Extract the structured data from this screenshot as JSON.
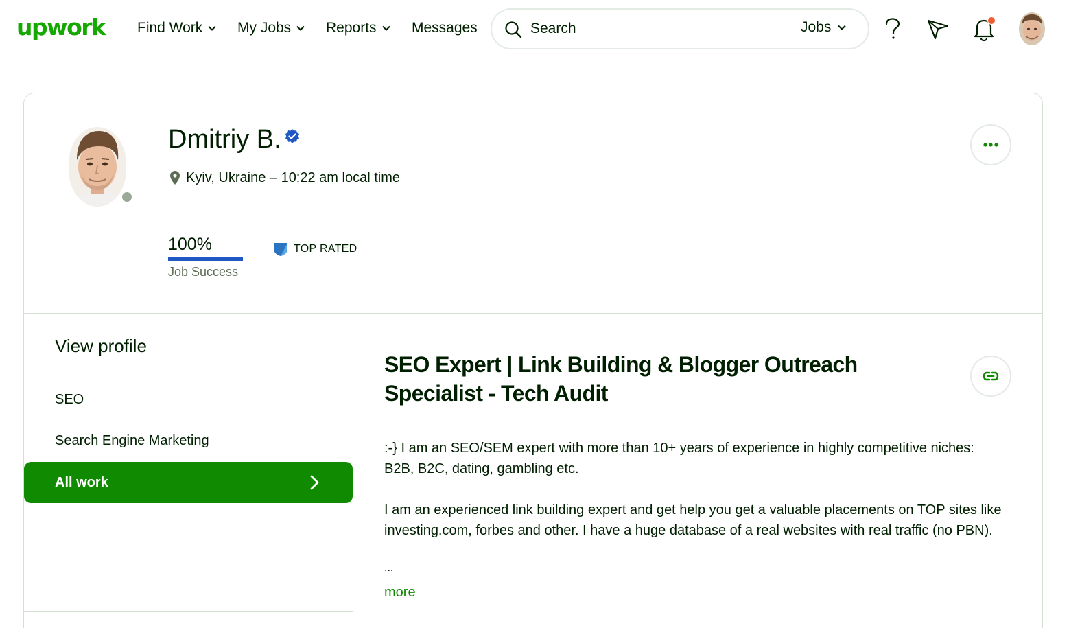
{
  "brand": {
    "logo_text": "upwork",
    "accent": "#14a800",
    "button_green": "#108a00"
  },
  "nav": {
    "items": [
      {
        "label": "Find Work",
        "has_dropdown": true
      },
      {
        "label": "My Jobs",
        "has_dropdown": true
      },
      {
        "label": "Reports",
        "has_dropdown": true
      },
      {
        "label": "Messages",
        "has_dropdown": false
      }
    ]
  },
  "search": {
    "placeholder": "Search",
    "scope": "Jobs"
  },
  "header_icons": [
    "help-icon",
    "send-icon",
    "notification-bell-icon",
    "user-avatar"
  ],
  "profile": {
    "name": "Dmitriy B.",
    "verified": true,
    "location": "Kyiv, Ukraine – 10:22 am local time",
    "job_success_value": "100%",
    "job_success_fraction": 1.0,
    "job_success_label": "Job Success",
    "badge": "TOP RATED",
    "online_status_color": "#9aaa97"
  },
  "sidebar": {
    "title": "View profile",
    "items": [
      {
        "label": "SEO",
        "active": false
      },
      {
        "label": "Search Engine Marketing",
        "active": false
      },
      {
        "label": "All work",
        "active": true
      }
    ]
  },
  "main": {
    "title": "SEO Expert | Link Building & Blogger Outreach Specialist - Tech Audit",
    "description_paragraphs": [
      ":-} I am an SEO/SEM expert with more than 10+ years of experience in highly competitive niches: B2B, B2C, dating, gambling etc.",
      "I am an experienced link building expert and get help you get a valuable placements on TOP sites like investing.com, forbes and other. I have a huge database of a real websites with real traffic (no PBN).",
      "..."
    ],
    "more_label": "more"
  }
}
